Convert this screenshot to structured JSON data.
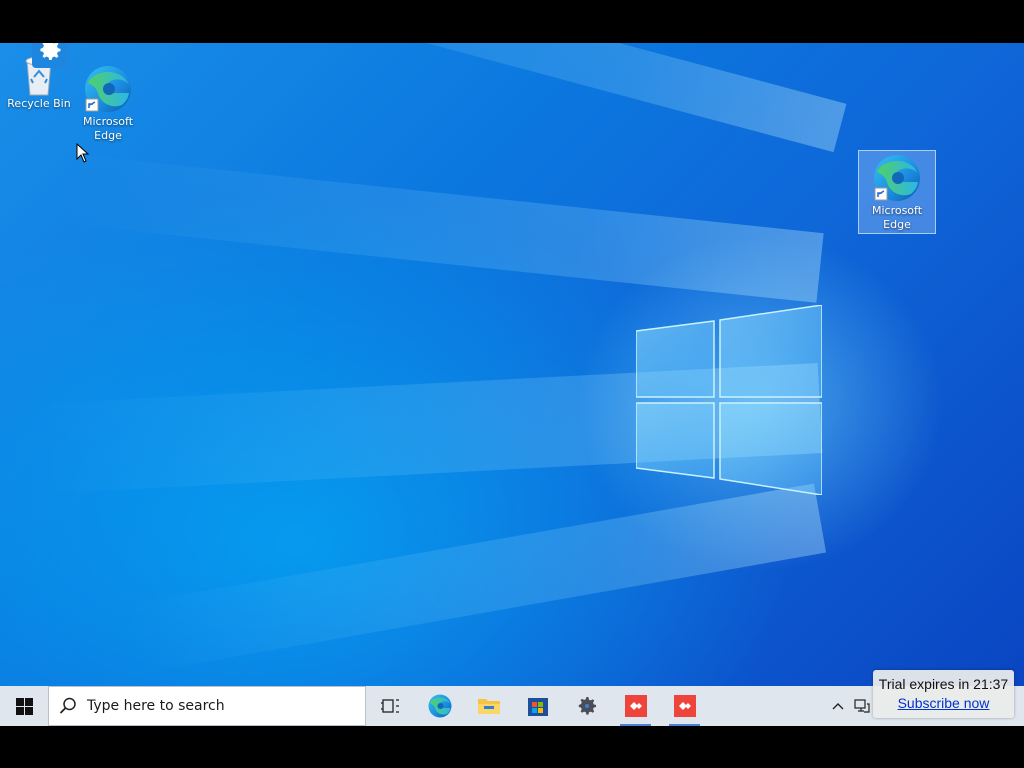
{
  "desktop": {
    "icons": [
      {
        "label": "Recycle Bin",
        "icon": "recycle-bin-icon"
      },
      {
        "label": "Microsoft Edge",
        "icon": "edge-icon"
      },
      {
        "label": "Microsoft Edge",
        "icon": "edge-icon",
        "selected": true
      }
    ],
    "overlay_icon": "settings-gear-icon"
  },
  "taskbar": {
    "search_placeholder": "Type here to search",
    "pinned": [
      {
        "name": "task-view",
        "icon": "task-view-icon"
      },
      {
        "name": "edge",
        "icon": "edge-icon"
      },
      {
        "name": "file-explorer",
        "icon": "folder-icon"
      },
      {
        "name": "store",
        "icon": "store-icon"
      },
      {
        "name": "settings",
        "icon": "gear-icon"
      },
      {
        "name": "anydesk-1",
        "icon": "anydesk-icon",
        "active": true
      },
      {
        "name": "anydesk-2",
        "icon": "anydesk-icon",
        "active": true
      }
    ]
  },
  "trial_popup": {
    "text": "Trial expires in 21:37",
    "link": "Subscribe now"
  },
  "colors": {
    "taskbar": "#dfe6ee",
    "accent": "#4f7ed8",
    "anydesk": "#ef443b"
  }
}
